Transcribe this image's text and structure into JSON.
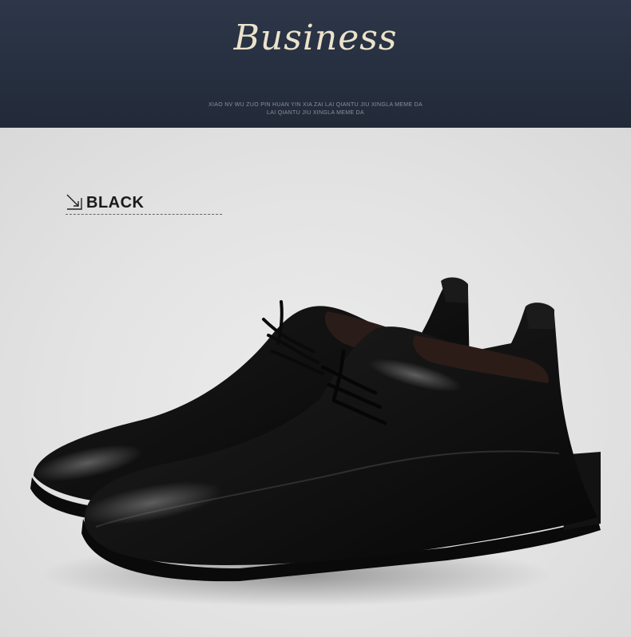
{
  "banner": {
    "title": "Business",
    "subtitle_line1": "XIAO NV WU ZUO PIN HUAN YIN XIA ZAI LAI QIANTU JIU XINGLA MEME DA",
    "subtitle_line2": "LAI QIANTU JIU XINGLA MEME DA"
  },
  "product": {
    "color_name": "BLACK",
    "image_subject": "pair-of-black-leather-derby-shoes"
  },
  "colors": {
    "banner_bg": "#262f3f",
    "title_gold": "#ece2cc",
    "stage_bg": "#e3e3e3"
  }
}
